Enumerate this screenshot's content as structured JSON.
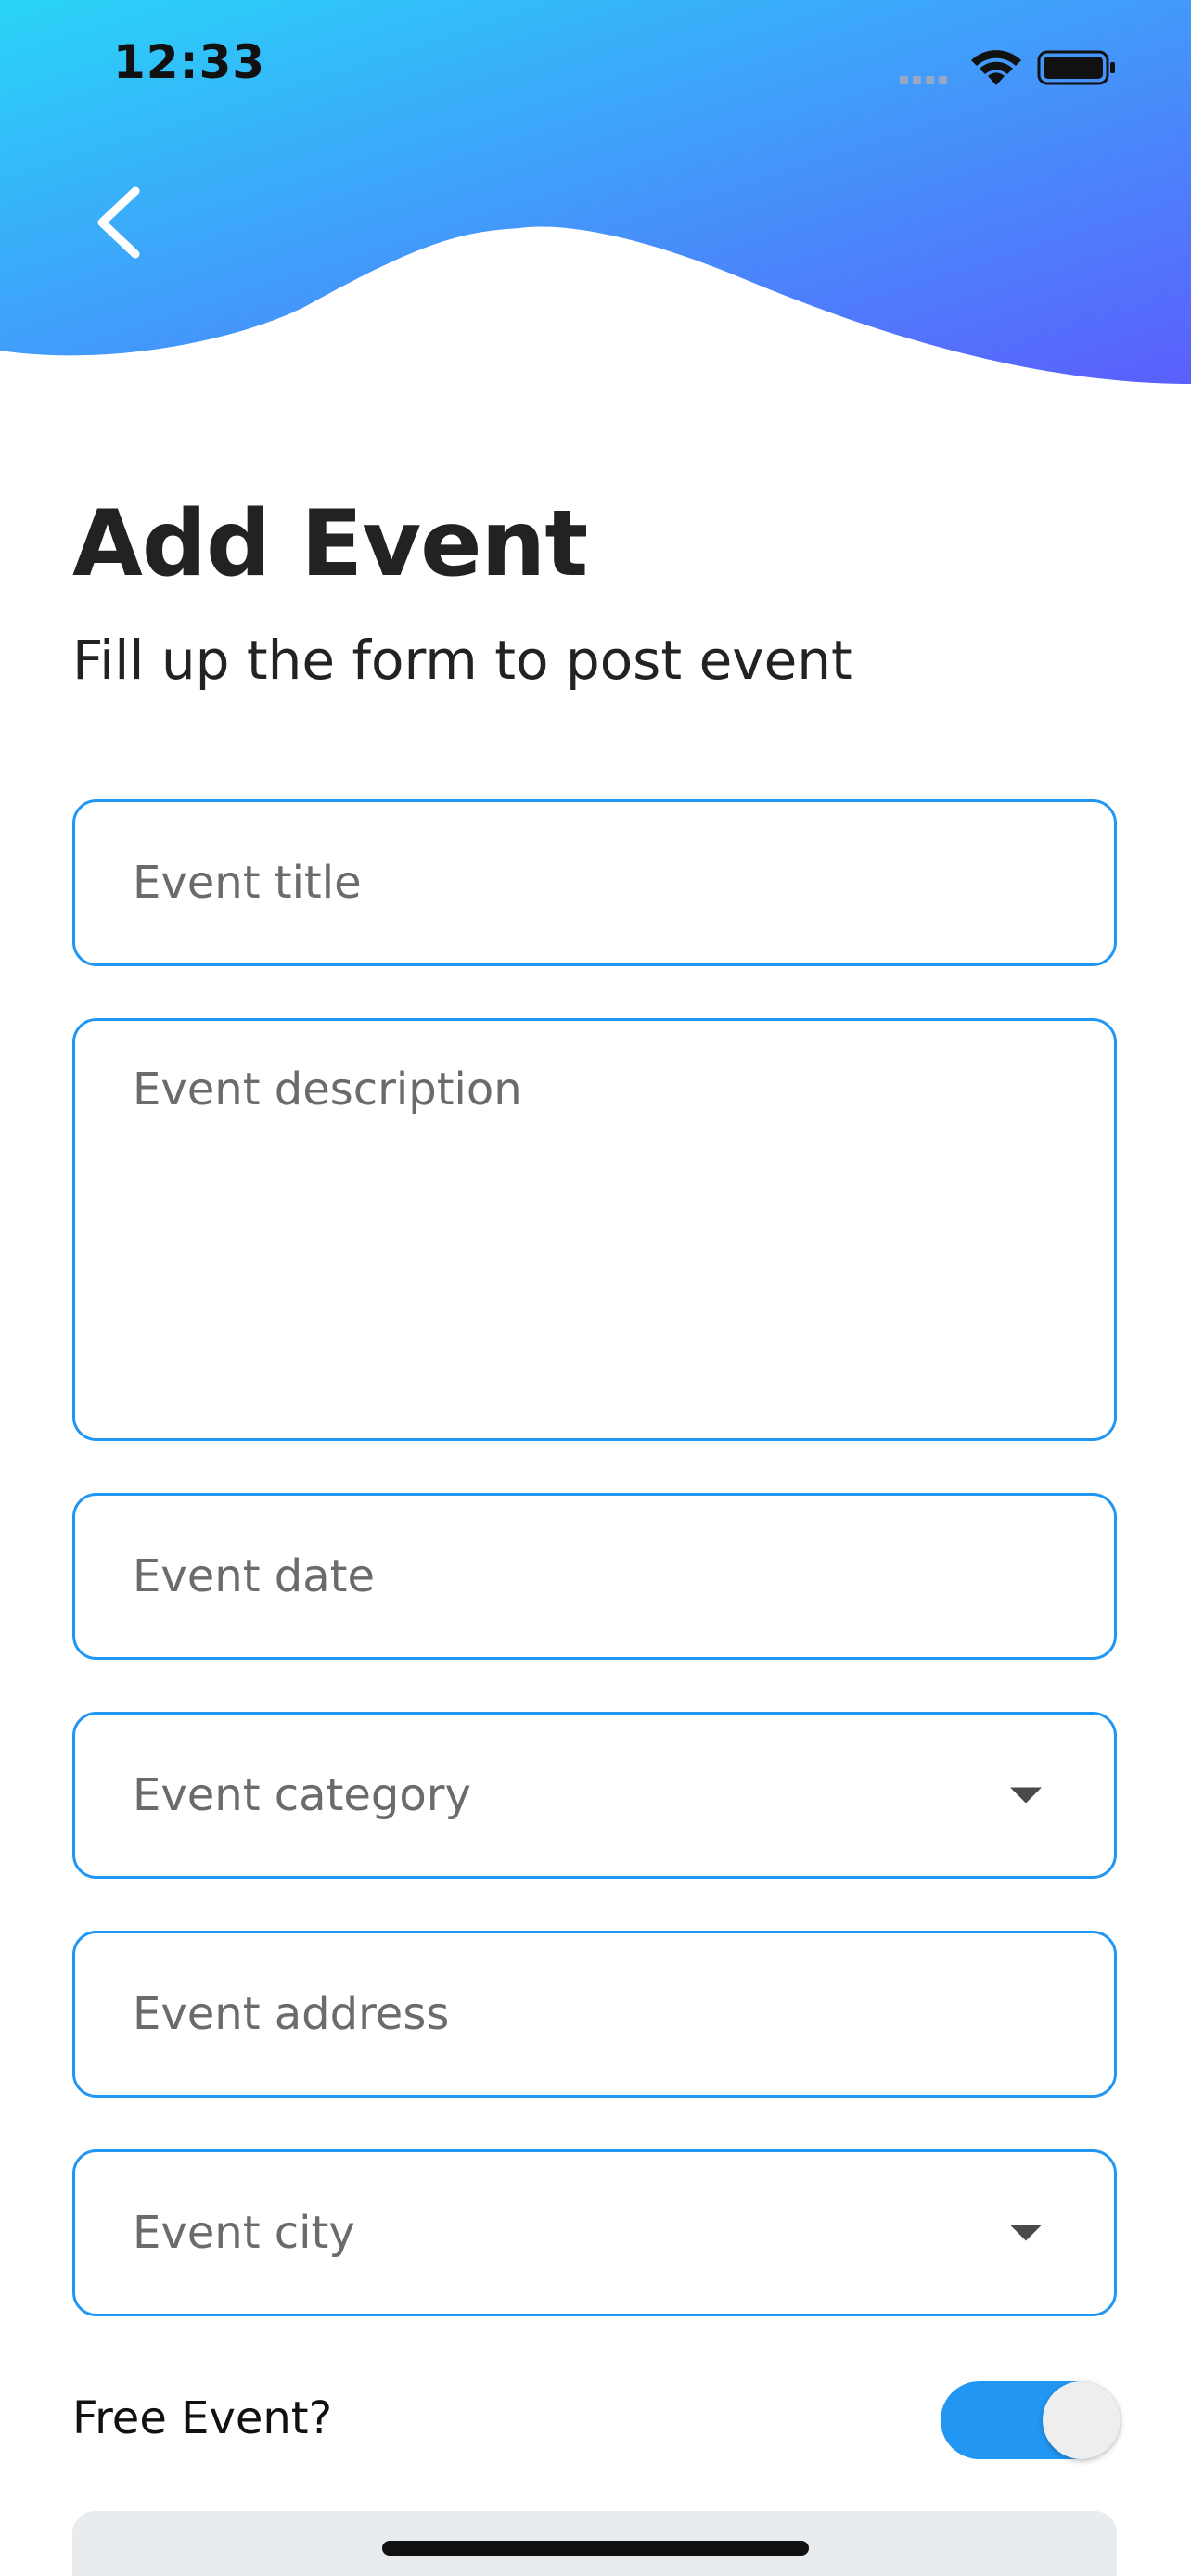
{
  "status_bar": {
    "time": "12:33"
  },
  "header": {
    "back_icon": "chevron-left-icon",
    "gradient_start": "#29d4f8",
    "gradient_end": "#5b5ffc"
  },
  "page": {
    "title": "Add Event",
    "subtitle": "Fill up the form to post event"
  },
  "form": {
    "event_title": {
      "value": "",
      "placeholder": "Event title"
    },
    "event_description": {
      "value": "",
      "placeholder": "Event description"
    },
    "event_date": {
      "value": "",
      "placeholder": "Event date"
    },
    "event_category": {
      "value": "",
      "placeholder": "Event category"
    },
    "event_address": {
      "value": "",
      "placeholder": "Event address"
    },
    "event_city": {
      "value": "",
      "placeholder": "Event city"
    },
    "free_event": {
      "label": "Free Event?",
      "checked": true
    }
  },
  "colors": {
    "accent": "#2196f3",
    "title_text": "#222222",
    "placeholder_text": "#6b6b6b"
  }
}
